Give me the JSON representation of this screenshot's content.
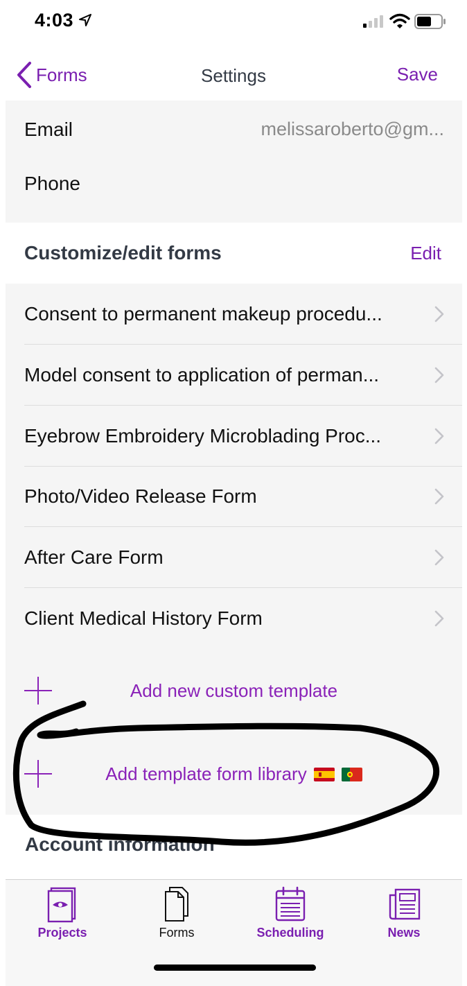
{
  "status_bar": {
    "time": "4:03",
    "icons": [
      "location-arrow-icon",
      "cellular-signal-icon",
      "wifi-icon",
      "battery-icon"
    ]
  },
  "nav": {
    "back_label": "Forms",
    "title": "Settings",
    "save_label": "Save"
  },
  "contact": {
    "email_label": "Email",
    "email_value": "melissaroberto@gm...",
    "phone_label": "Phone",
    "phone_value": ""
  },
  "customize": {
    "title": "Customize/edit forms",
    "edit_label": "Edit",
    "forms": [
      {
        "label": "Consent to permanent makeup procedu..."
      },
      {
        "label": "Model consent to application of perman..."
      },
      {
        "label": "Eyebrow Embroidery Microblading Proc..."
      },
      {
        "label": "Photo/Video Release Form"
      },
      {
        "label": "After Care Form"
      },
      {
        "label": "Client Medical History Form"
      }
    ],
    "add_custom_label": "Add new custom template",
    "add_library_label": "Add template form library",
    "library_flags": [
      "spain-flag-icon",
      "portugal-flag-icon"
    ]
  },
  "account": {
    "title": "Account information"
  },
  "tabs": [
    {
      "label": "Projects",
      "icon": "projects-eye-icon",
      "active": false
    },
    {
      "label": "Forms",
      "icon": "forms-documents-icon",
      "active": true
    },
    {
      "label": "Scheduling",
      "icon": "calendar-icon",
      "active": false
    },
    {
      "label": "News",
      "icon": "newspaper-icon",
      "active": false
    }
  ],
  "colors": {
    "accent": "#7a1fb0",
    "annotation": "#000000",
    "row_background": "#f5f5f5"
  }
}
